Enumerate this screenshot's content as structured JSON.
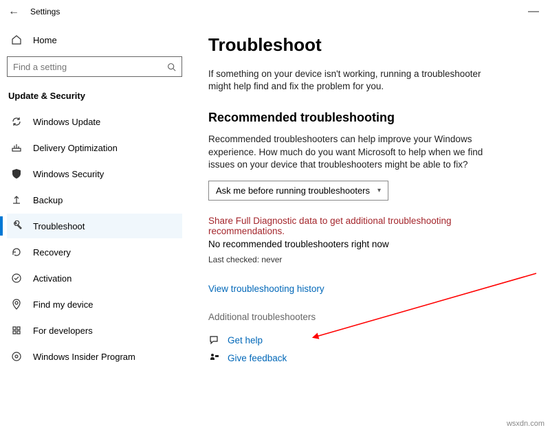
{
  "titlebar": {
    "back_icon": "←",
    "title": "Settings",
    "minimize": "—"
  },
  "sidebar": {
    "home_label": "Home",
    "search_placeholder": "Find a setting",
    "group_label": "Update & Security",
    "items": [
      {
        "label": "Windows Update"
      },
      {
        "label": "Delivery Optimization"
      },
      {
        "label": "Windows Security"
      },
      {
        "label": "Backup"
      },
      {
        "label": "Troubleshoot"
      },
      {
        "label": "Recovery"
      },
      {
        "label": "Activation"
      },
      {
        "label": "Find my device"
      },
      {
        "label": "For developers"
      },
      {
        "label": "Windows Insider Program"
      }
    ]
  },
  "main": {
    "title": "Troubleshoot",
    "intro": "If something on your device isn't working, running a troubleshooter might help find and fix the problem for you.",
    "rec_heading": "Recommended troubleshooting",
    "rec_text": "Recommended troubleshooters can help improve your Windows experience. How much do you want Microsoft to help when we find issues on your device that troubleshooters might be able to fix?",
    "select_value": "Ask me before running troubleshooters",
    "warn_text": "Share Full Diagnostic data to get additional troubleshooting recommendations.",
    "no_rec": "No recommended troubleshooters right now",
    "last_checked": "Last checked: never",
    "history_link": "View troubleshooting history",
    "additional": "Additional troubleshooters",
    "get_help": "Get help",
    "give_feedback": "Give feedback"
  },
  "footer": "wsxdn.com"
}
